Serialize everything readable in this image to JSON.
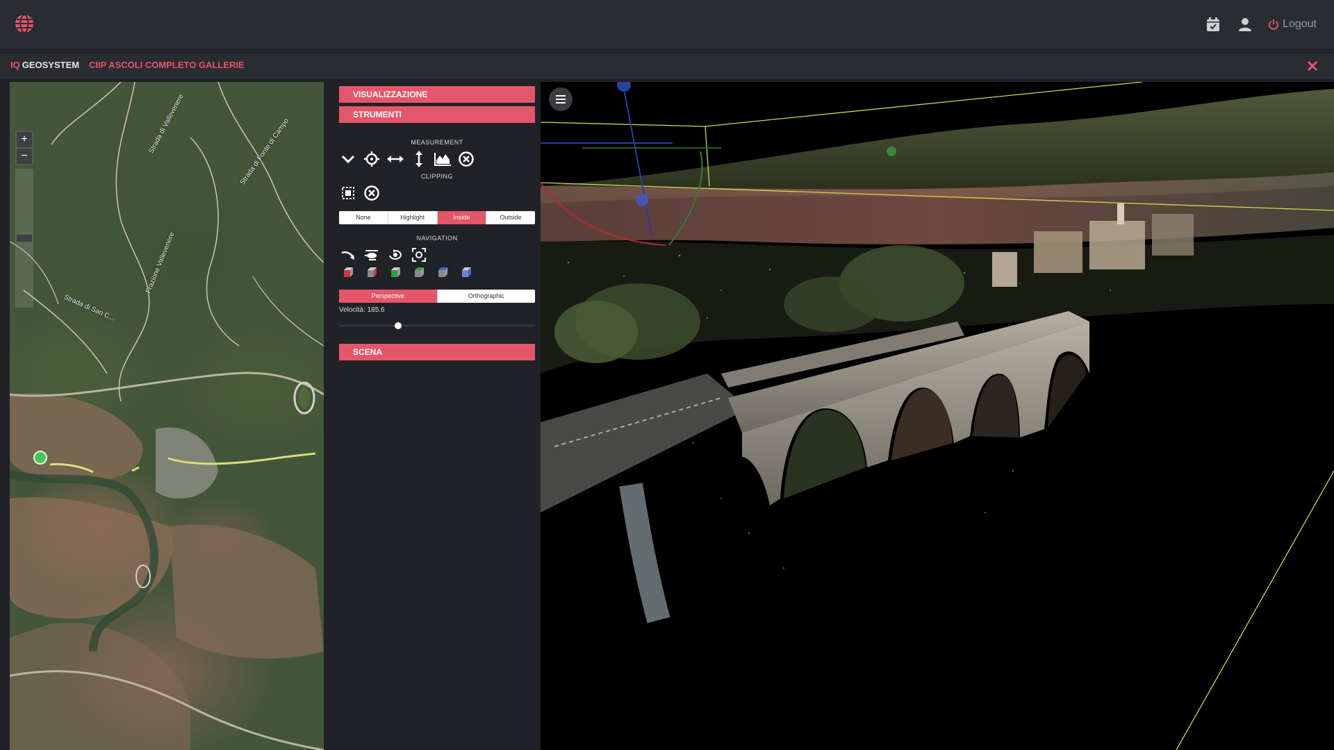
{
  "header": {
    "logout_label": "Logout",
    "icons": [
      "globe-icon",
      "calendar-icon",
      "user-icon",
      "power-icon"
    ]
  },
  "subheader": {
    "brand_prefix": "IQ",
    "brand_name": "GEOSYSTEM",
    "project_title": "CIIP ASCOLI COMPLETO GALLERIE",
    "close_icon": "close-icon"
  },
  "map": {
    "zoom_in_label": "+",
    "zoom_out_label": "−",
    "street_labels": [
      "Strada di Vallevenere",
      "Strada di Fonte di Campo",
      "Frazione Vallevenere",
      "Strada di San C..."
    ]
  },
  "tools": {
    "visualizzazione_label": "VISUALIZZAZIONE",
    "strumenti_label": "STRUMENTI",
    "measurement_title": "MEASUREMENT",
    "clipping_title": "CLIPPING",
    "clip_modes": [
      "None",
      "Highlight",
      "Inside",
      "Outside"
    ],
    "clip_active": "Inside",
    "navigation_title": "NAVIGATION",
    "projection_modes": [
      "Perspective",
      "Orthographic"
    ],
    "projection_active": "Perspective",
    "speed_label": "Velocità: 185.6",
    "speed_fraction": 0.3,
    "scena_label": "SCENA"
  },
  "colors": {
    "accent": "#e4566a",
    "background": "#202227",
    "bar": "#2a2c32"
  }
}
